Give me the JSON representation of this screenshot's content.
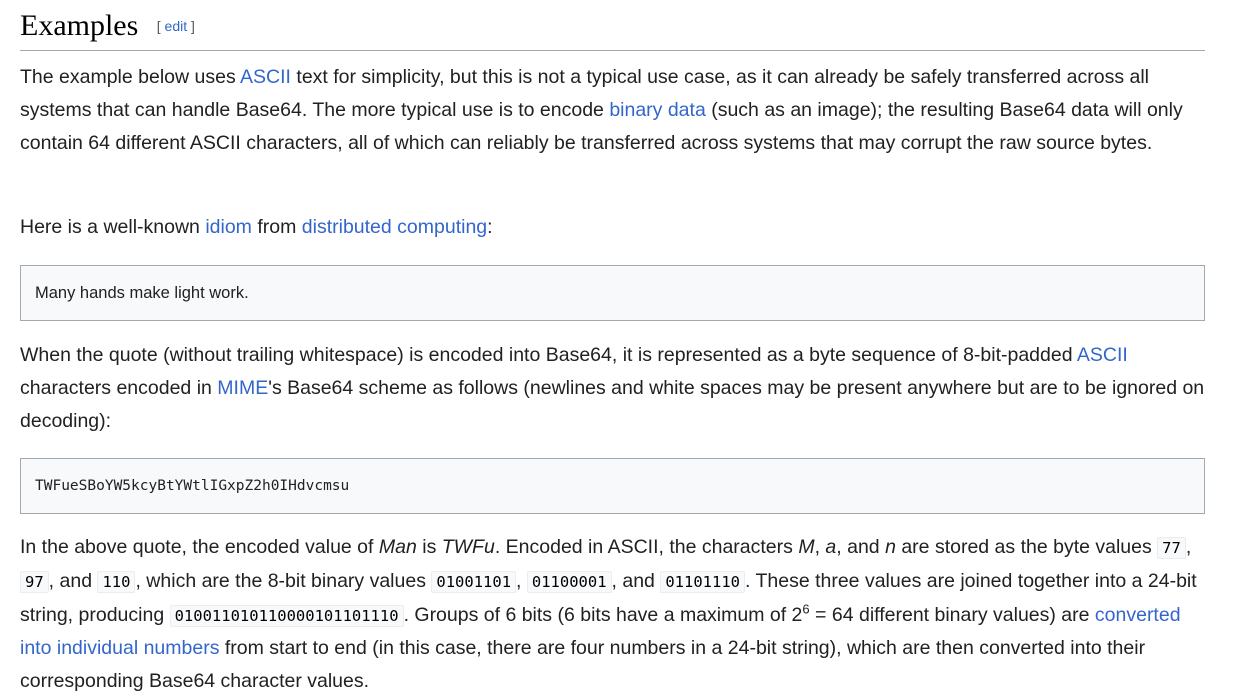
{
  "section": {
    "title": "Examples",
    "edit_open": "[",
    "edit_label": "edit",
    "edit_close": "]"
  },
  "para1": {
    "t1": "The example below uses ",
    "l1": "ASCII",
    "t2": " text for simplicity, but this is not a typical use case, as it can already be safely transferred across all systems that can handle Base64. The more typical use is to encode ",
    "l2": "binary data",
    "t3": " (such as an image); the resulting Base64 data will only contain 64 different ASCII characters, all of which can reliably be transferred across systems that may corrupt the raw source bytes."
  },
  "para2": {
    "t1": "Here is a well-known ",
    "l1": "idiom",
    "t2": " from ",
    "l2": "distributed computing",
    "t3": ":"
  },
  "quote1": "Many hands make light work.",
  "para3": {
    "t1": "When the quote (without trailing whitespace) is encoded into Base64, it is represented as a byte sequence of 8-bit-padded ",
    "l1": "ASCII",
    "t2": " characters encoded in ",
    "l2": "MIME",
    "t3": "'s Base64 scheme as follows (newlines and white spaces may be present anywhere but are to be ignored on decoding):"
  },
  "quote2": "TWFueSBoYW5kcyBtYWtlIGxpZ2h0IHdvcmsu",
  "para4": {
    "t1": "In the above quote, the encoded value of ",
    "i1": "Man",
    "t2": " is ",
    "i2": "TWFu",
    "t3": ". Encoded in ASCII, the characters ",
    "i3": "M",
    "t4": ", ",
    "i4": "a",
    "t5": ", and ",
    "i5": "n",
    "t6": " are stored as the byte values ",
    "c1": "77",
    "t7": ", ",
    "c2": "97",
    "t8": ", and ",
    "c3": "110",
    "t9": ", which are the 8-bit binary values ",
    "c4": "01001101",
    "t10": ", ",
    "c5": "01100001",
    "t11": ", and ",
    "c6": "01101110",
    "t12": ". These three values are joined together into a 24-bit string, producing ",
    "c7": "010011010110000101101110",
    "t13": ". Groups of 6 bits (6 bits have a maximum of 2",
    "sup": "6",
    "t14": " = 64 different binary values) are ",
    "l1": "converted into individual numbers",
    "t15": " from start to end (in this case, there are four numbers in a 24-bit string), which are then converted into their corresponding Base64 character values."
  }
}
